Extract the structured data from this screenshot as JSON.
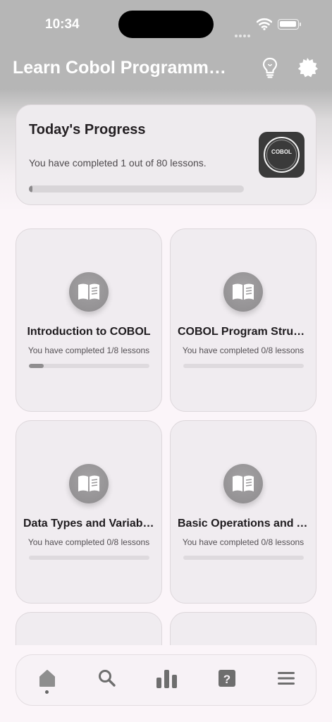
{
  "status_bar": {
    "time": "10:34"
  },
  "header": {
    "title": "Learn Cobol Programming",
    "bulb_icon": "lightbulb-icon",
    "settings_icon": "gear-badge-icon"
  },
  "progress": {
    "title": "Today's Progress",
    "summary": "You have completed 1 out of 80 lessons.",
    "completed": 1,
    "total": 80,
    "logo_text": "COBOL"
  },
  "courses": [
    {
      "title": "Introduction to COBOL",
      "summary": "You have completed 1/8 lessons",
      "completed": 1,
      "total": 8
    },
    {
      "title": "COBOL Program Structure",
      "summary": "You have completed 0/8 lessons",
      "completed": 0,
      "total": 8
    },
    {
      "title": "Data Types and Variables",
      "summary": "You have completed 0/8 lessons",
      "completed": 0,
      "total": 8
    },
    {
      "title": "Basic Operations and Arithmetic",
      "summary": "You have completed 0/8 lessons",
      "completed": 0,
      "total": 8
    }
  ],
  "tabbar": {
    "items": [
      {
        "icon": "home-icon",
        "active": true
      },
      {
        "icon": "search-icon",
        "active": false
      },
      {
        "icon": "bar-chart-icon",
        "active": false
      },
      {
        "icon": "question-icon",
        "active": false
      },
      {
        "icon": "menu-icon",
        "active": false
      }
    ]
  },
  "colors": {
    "header_gray": "#b6b6b6",
    "background": "#fbf5f9",
    "card": "#f0ecf0",
    "progress_fill": "#8c8a8c"
  }
}
